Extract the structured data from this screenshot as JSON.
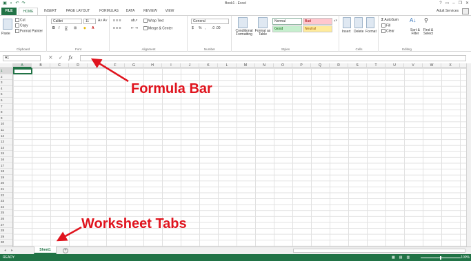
{
  "window": {
    "title": "Book1 - Excel",
    "controls": [
      "?",
      "▭",
      "–",
      "❐",
      "✕"
    ]
  },
  "ribbon_tabs": [
    "FILE",
    "HOME",
    "INSERT",
    "PAGE LAYOUT",
    "FORMULAS",
    "DATA",
    "REVIEW",
    "VIEW"
  ],
  "user": "Adult Services",
  "clipboard": {
    "paste": "Paste",
    "cut": "Cut",
    "copy": "Copy",
    "format_painter": "Format Painter",
    "label": "Clipboard"
  },
  "font": {
    "name": "Calibri",
    "size": "11",
    "bold": "B",
    "italic": "I",
    "underline": "U",
    "label": "Font"
  },
  "alignment": {
    "wrap": "Wrap Text",
    "merge": "Merge & Center",
    "label": "Alignment"
  },
  "number": {
    "format": "General",
    "currency": "$",
    "percent": "%",
    "comma": ",",
    "label": "Number"
  },
  "styles": {
    "conditional": "Conditional Formatting",
    "format_as_table": "Format as Table",
    "normal": "Normal",
    "bad": "Bad",
    "good": "Good",
    "neutral": "Neutral",
    "label": "Styles"
  },
  "cells_grp": {
    "insert": "Insert",
    "delete": "Delete",
    "format": "Format",
    "label": "Cells"
  },
  "editing": {
    "autosum": "AutoSum",
    "fill": "Fill",
    "clear": "Clear",
    "sort": "Sort & Filter",
    "find": "Find & Select",
    "label": "Editing"
  },
  "formula_bar": {
    "name_box": "A1",
    "fx": "fx",
    "cancel": "✕",
    "enter": "✓"
  },
  "columns": [
    "A",
    "B",
    "C",
    "D",
    "E",
    "F",
    "G",
    "H",
    "I",
    "J",
    "K",
    "L",
    "M",
    "N",
    "O",
    "P",
    "Q",
    "R",
    "S",
    "T",
    "U",
    "V",
    "W",
    "X"
  ],
  "rows": [
    "1",
    "2",
    "3",
    "4",
    "5",
    "6",
    "7",
    "8",
    "9",
    "10",
    "11",
    "12",
    "13",
    "14",
    "15",
    "16",
    "17",
    "18",
    "19",
    "20",
    "21",
    "22",
    "23",
    "24",
    "25",
    "26",
    "27",
    "28",
    "29",
    "30"
  ],
  "sheet": {
    "tab": "Sheet1",
    "add": "+"
  },
  "status": {
    "ready": "READY",
    "zoom": "100%"
  },
  "annotations": {
    "formula_bar": "Formula Bar",
    "worksheet_tabs": "Worksheet Tabs"
  },
  "colors": {
    "excel_green": "#217346",
    "annotation_red": "#e0141e",
    "bad_fill": "#ffc7ce",
    "good_fill": "#c6efce",
    "neutral_fill": "#ffeb9c"
  }
}
